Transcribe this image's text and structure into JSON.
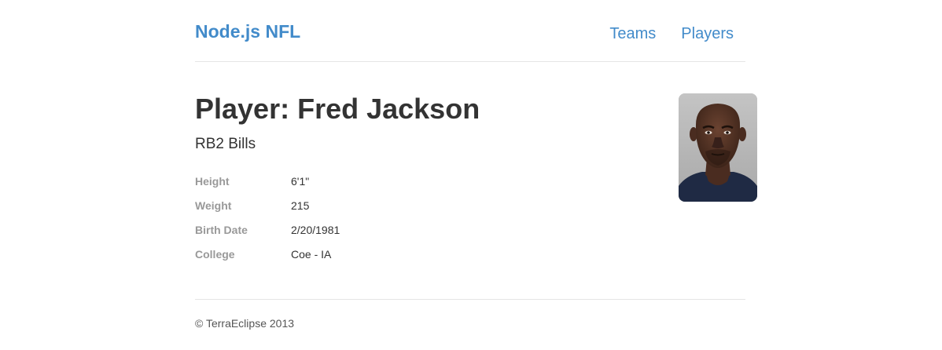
{
  "app": {
    "brand": "Node.js NFL"
  },
  "nav": {
    "items": [
      {
        "label": "Teams"
      },
      {
        "label": "Players"
      }
    ]
  },
  "player": {
    "title": "Player: Fred Jackson",
    "subtitle": "RB2 Bills",
    "photo_icon": "player-headshot",
    "details": [
      {
        "label": "Height",
        "value": "6'1\""
      },
      {
        "label": "Weight",
        "value": "215"
      },
      {
        "label": "Birth Date",
        "value": "2/20/1981"
      },
      {
        "label": "College",
        "value": "Coe - IA"
      }
    ]
  },
  "footer": {
    "copyright": "© TerraEclipse 2013"
  },
  "colors": {
    "link": "#428bca",
    "label": "#999999",
    "text": "#333333",
    "divider": "#e5e5e5"
  }
}
